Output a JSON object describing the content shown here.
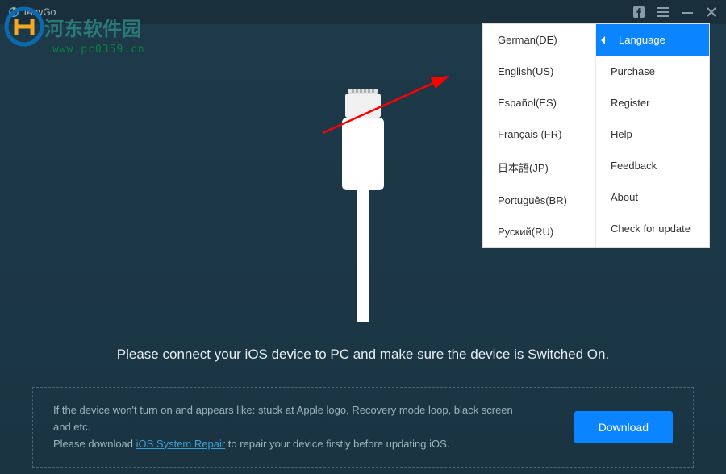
{
  "app": {
    "name": "iAnyGo"
  },
  "watermark": {
    "text": "河东软件园",
    "url": "www.pc0359.cn"
  },
  "menu": {
    "main": [
      {
        "label": "Language",
        "selected": true
      },
      {
        "label": "Purchase",
        "selected": false
      },
      {
        "label": "Register",
        "selected": false
      },
      {
        "label": "Help",
        "selected": false
      },
      {
        "label": "Feedback",
        "selected": false
      },
      {
        "label": "About",
        "selected": false
      },
      {
        "label": "Check for update",
        "selected": false
      }
    ],
    "languages": [
      "German(DE)",
      "English(US)",
      "Español(ES)",
      "Français (FR)",
      "日本語(JP)",
      "Português(BR)",
      "Pуский(RU)"
    ]
  },
  "main_text": "Please connect your iOS device to PC and make sure the device is Switched On.",
  "footer": {
    "line1": "If the device won't turn on and appears like: stuck at Apple logo, Recovery mode loop, black screen and etc.",
    "line2_prefix": "Please download ",
    "line2_link": "iOS System Repair",
    "line2_suffix": " to repair your device firstly before updating iOS.",
    "button": "Download"
  }
}
